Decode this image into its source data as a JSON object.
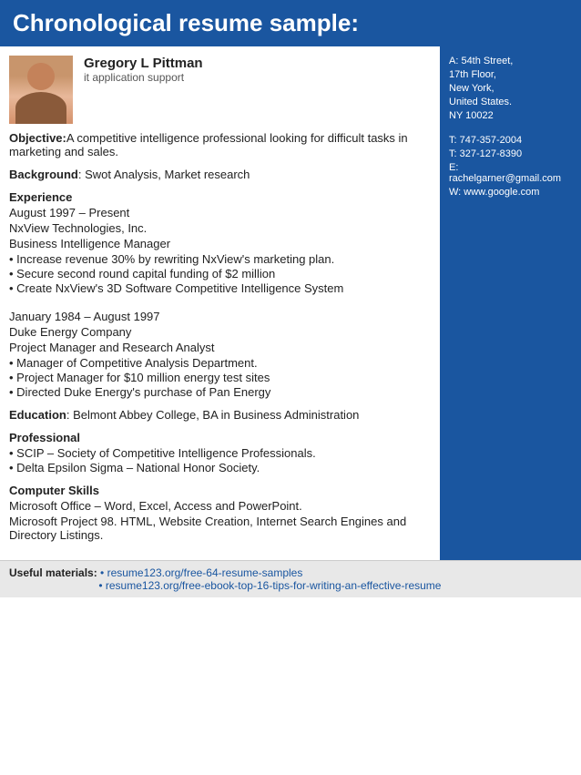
{
  "page": {
    "title": "Chronological resume sample:"
  },
  "header": {
    "name": "Gregory L Pittman",
    "role": "it application support"
  },
  "contact": {
    "address": "A: 54th Street,",
    "address2": "17th Floor,",
    "city": "New York,",
    "country": "United States.",
    "zip": "NY 10022",
    "phone1": "T: 747-357-2004",
    "phone2": "T: 327-127-8390",
    "email": "E: rachelgarner@gmail.com",
    "website": "W: www.google.com"
  },
  "objective": {
    "label": "Objective:",
    "text": "A competitive intelligence professional looking for difficult tasks in marketing and sales."
  },
  "background": {
    "label": "Background",
    "text": ": Swot Analysis, Market research"
  },
  "experience": {
    "label": "Experience",
    "job1": {
      "dates": "August 1997 – Present",
      "company": "NxView Technologies, Inc.",
      "title": "Business Intelligence Manager",
      "bullets": [
        "• Increase revenue 30% by rewriting NxView's marketing plan.",
        "• Secure second round capital funding of $2 million",
        "• Create NxView's 3D Software Competitive Intelligence System"
      ]
    },
    "job2": {
      "dates": "January 1984 – August 1997",
      "company": "Duke Energy Company",
      "title": "Project Manager and Research Analyst",
      "bullets": [
        "• Manager of Competitive Analysis Department.",
        "• Project Manager for $10 million energy test sites",
        "• Directed Duke Energy's purchase of Pan Energy"
      ]
    }
  },
  "education": {
    "label": "Education",
    "text": ": Belmont Abbey College, BA in Business Administration"
  },
  "professional": {
    "label": "Professional",
    "bullets": [
      "• SCIP – Society of Competitive Intelligence Professionals.",
      "• Delta Epsilon Sigma – National Honor Society."
    ]
  },
  "computer_skills": {
    "label": "Computer Skills",
    "lines": [
      "Microsoft Office – Word, Excel, Access and PowerPoint.",
      "Microsoft Project 98. HTML, Website Creation, Internet Search Engines and Directory Listings."
    ]
  },
  "useful_materials": {
    "label": "Useful materials:",
    "links": [
      "• resume123.org/free-64-resume-samples",
      "• resume123.org/free-ebook-top-16-tips-for-writing-an-effective-resume"
    ]
  }
}
